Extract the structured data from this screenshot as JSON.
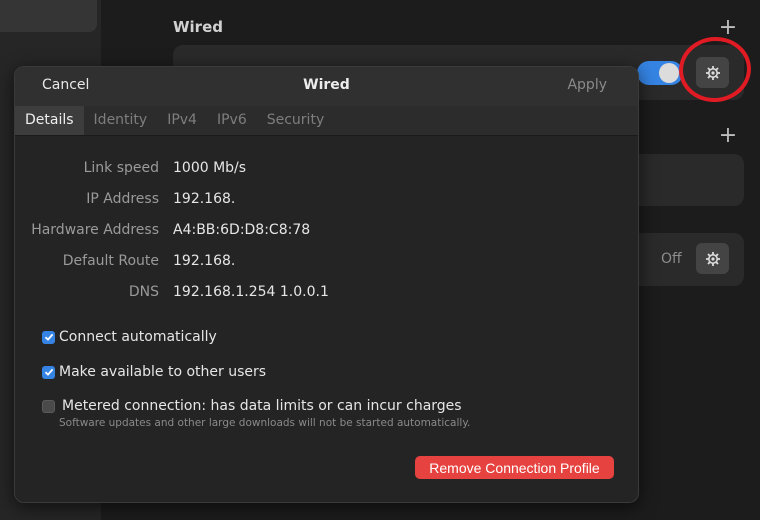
{
  "background": {
    "section_title": "Wired",
    "off_label": "Off",
    "icons": [
      "plus-icon",
      "gear-icon"
    ],
    "colors": {
      "toggle_on": "#3584e4",
      "annotation": "#e01b24"
    }
  },
  "dialog": {
    "cancel_label": "Cancel",
    "title": "Wired",
    "apply_label": "Apply",
    "tabs": [
      {
        "label": "Details",
        "active": true
      },
      {
        "label": "Identity",
        "active": false
      },
      {
        "label": "IPv4",
        "active": false
      },
      {
        "label": "IPv6",
        "active": false
      },
      {
        "label": "Security",
        "active": false
      }
    ],
    "details": [
      {
        "label": "Link speed",
        "value": "1000 Mb/s"
      },
      {
        "label": "IP Address",
        "value": "192.168."
      },
      {
        "label": "Hardware Address",
        "value": "A4:BB:6D:D8:C8:78"
      },
      {
        "label": "Default Route",
        "value": "192.168."
      },
      {
        "label": "DNS",
        "value": "192.168.1.254 1.0.0.1"
      }
    ],
    "checks": {
      "connect_auto": {
        "label": "Connect automatically",
        "checked": true
      },
      "available_all": {
        "label": "Make available to other users",
        "checked": true
      },
      "metered": {
        "label": "Metered connection: has data limits or can incur charges",
        "sublabel": "Software updates and other large downloads will not be started automatically.",
        "checked": false
      }
    },
    "remove_label": "Remove Connection Profile",
    "colors": {
      "destructive": "#e6423f",
      "check_on": "#3584e4"
    }
  }
}
